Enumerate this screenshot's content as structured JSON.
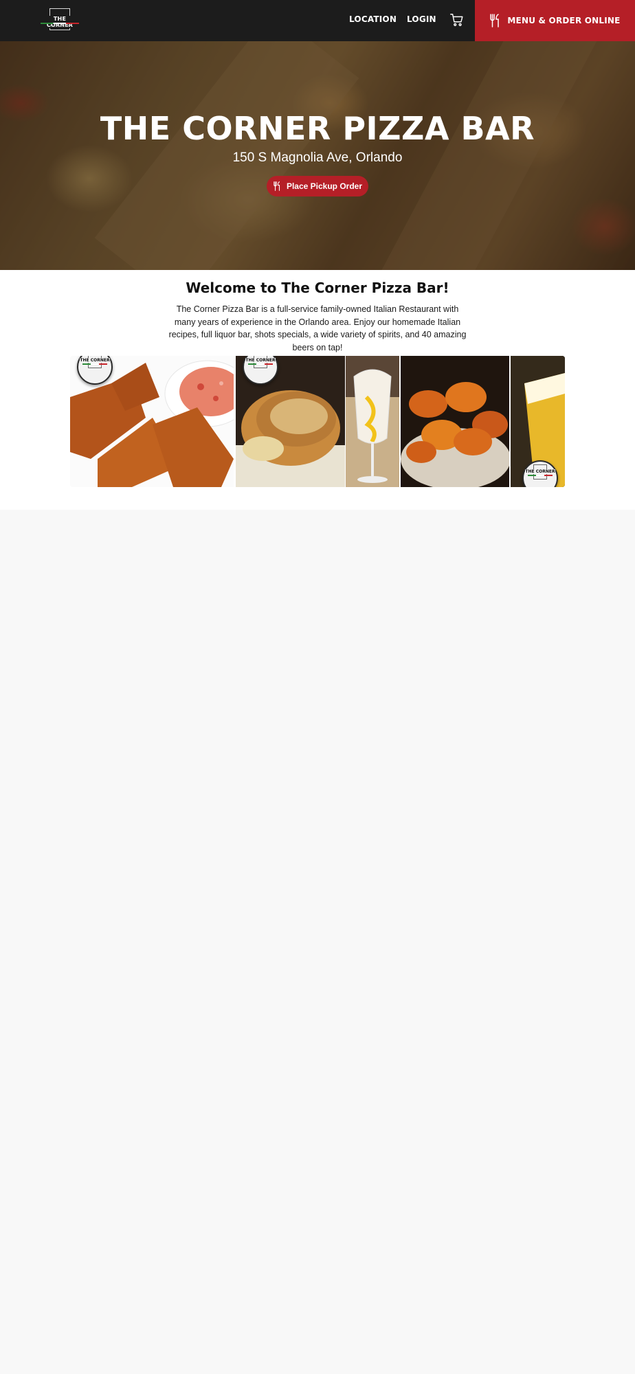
{
  "header": {
    "logo_text": "THE CORNER",
    "logo_subtext": "PIZZA BAR",
    "nav": {
      "location": "LOCATION",
      "login": "LOGIN"
    },
    "order_button": "MENU & ORDER ONLINE",
    "icons": {
      "cart": "cart-icon",
      "utensils": "utensils-icon"
    }
  },
  "hero": {
    "title": "THE CORNER PIZZA BAR",
    "address": "150 S Magnolia Ave, Orlando",
    "pickup_button": "Place Pickup Order"
  },
  "welcome": {
    "title": "Welcome to The Corner Pizza Bar!",
    "text": "The Corner Pizza Bar is a full-service family-owned Italian Restaurant with many years of experience in the Orlando area. Enjoy our homemade Italian recipes, full liquor bar, shots specials, a wide variety of spirits, and 40 amazing beers on tap!"
  },
  "gallery": {
    "badge_text": "THE CORNER",
    "images": [
      "fried-ravioli-photo",
      "garlic-knot-photo",
      "cocktail-photo",
      "buffalo-wings-photo",
      "beer-photo"
    ]
  },
  "colors": {
    "header_bg": "#1c1c1c",
    "accent": "#b51f27",
    "page_bg": "#f8f8f8"
  }
}
